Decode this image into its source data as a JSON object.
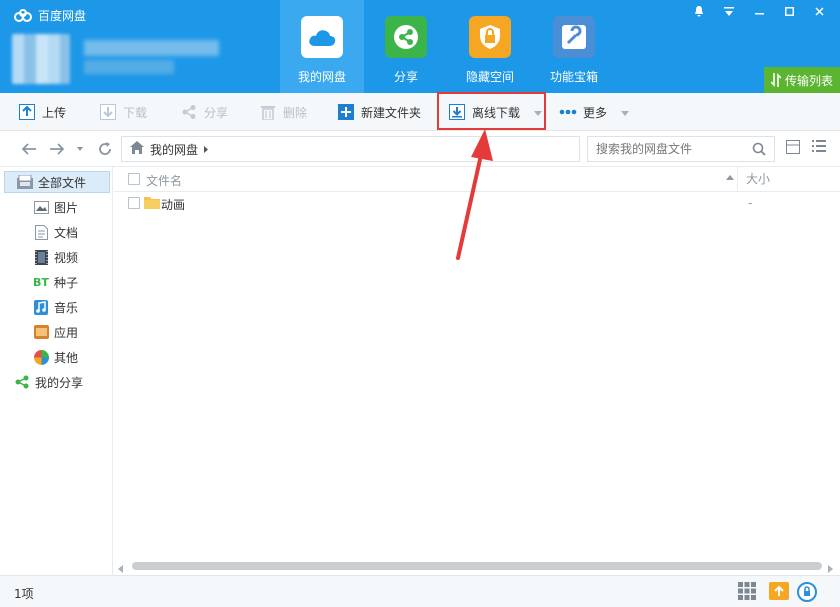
{
  "app": {
    "title": "百度网盘"
  },
  "window_controls": [
    "notification-icon",
    "menu-icon",
    "minimize-icon",
    "maximize-icon",
    "close-icon"
  ],
  "nav_tabs": [
    {
      "label": "我的网盘",
      "icon": "cloud-icon",
      "active": true,
      "color": "#3aa9f0"
    },
    {
      "label": "分享",
      "icon": "share-icon",
      "active": false,
      "color": "#3bb54a"
    },
    {
      "label": "隐藏空间",
      "icon": "lock-icon",
      "active": false,
      "color": "#f5a623"
    },
    {
      "label": "功能宝箱",
      "icon": "tools-icon",
      "active": false,
      "color": "#4a8fd6"
    }
  ],
  "transfer_list": {
    "label": "传输列表"
  },
  "toolbar": {
    "upload": "上传",
    "download": "下载",
    "share": "分享",
    "delete": "删除",
    "new_folder": "新建文件夹",
    "offline_download": "离线下载",
    "more": "更多"
  },
  "address": {
    "path": "我的网盘",
    "search_placeholder": "搜索我的网盘文件"
  },
  "sidebar": {
    "items": [
      {
        "label": "全部文件",
        "icon": "all-files-icon",
        "active": true
      },
      {
        "label": "图片",
        "icon": "image-icon"
      },
      {
        "label": "文档",
        "icon": "document-icon"
      },
      {
        "label": "视频",
        "icon": "video-icon"
      },
      {
        "label": "种子",
        "icon": "bt-icon",
        "badge": "BT"
      },
      {
        "label": "音乐",
        "icon": "music-icon"
      },
      {
        "label": "应用",
        "icon": "app-icon"
      },
      {
        "label": "其他",
        "icon": "other-icon"
      },
      {
        "label": "我的分享",
        "icon": "my-share-icon"
      }
    ]
  },
  "file_list": {
    "columns": {
      "name": "文件名",
      "size": "大小"
    },
    "rows": [
      {
        "name": "动画",
        "size": "-",
        "type": "folder"
      }
    ]
  },
  "status": {
    "count": "1项"
  },
  "colors": {
    "header": "#1d97e8",
    "highlight": "#e53a3a",
    "transfer_button": "#5cb531"
  }
}
